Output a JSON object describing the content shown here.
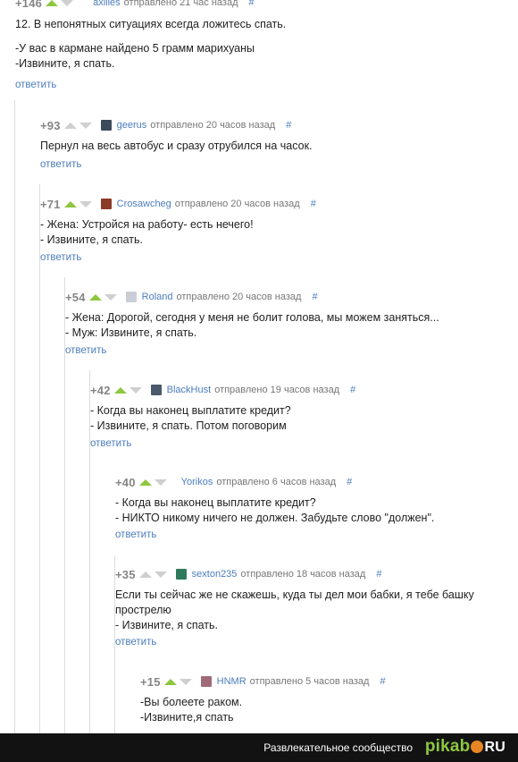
{
  "comments": [
    {
      "score": "+146",
      "author": "axilles",
      "meta": "отправлено 21 час назад",
      "hash": "#",
      "lines": [
        "12. В непонятных ситуациях всегда ложитесь спать.",
        "",
        "-У вас в кармане найдено 5 грамм марихуаны",
        "-Извините, я спать."
      ],
      "reply": "ответить"
    },
    {
      "score": "+93",
      "author": "geerus",
      "meta": "отправлено 20 часов назад",
      "hash": "#",
      "lines": [
        "Пернул на весь автобус и сразу отрубился на часок."
      ],
      "reply": "ответить"
    },
    {
      "score": "+71",
      "author": "Crosawcheg",
      "meta": "отправлено 20 часов назад",
      "hash": "#",
      "lines": [
        "- Жена: Устройся на работу- есть нечего!",
        "- Извините, я спать."
      ],
      "reply": "ответить"
    },
    {
      "score": "+54",
      "author": "Roland",
      "meta": "отправлено 20 часов назад",
      "hash": "#",
      "lines": [
        "- Жена: Дорогой, сегодня у меня не болит голова, мы можем заняться...",
        "- Муж: Извините, я спать."
      ],
      "reply": "ответить"
    },
    {
      "score": "+42",
      "author": "BlackHust",
      "meta": "отправлено 19 часов назад",
      "hash": "#",
      "lines": [
        "- Когда вы наконец выплатите кредит?",
        "- Извините, я спать. Потом поговорим"
      ],
      "reply": "ответить"
    },
    {
      "score": "+40",
      "author": "Yorikos",
      "meta": "отправлено 6 часов назад",
      "hash": "#",
      "lines": [
        "- Когда вы наконец выплатите кредит?",
        "- НИКТО никому ничего не должен. Забудьте слово \"должен\"."
      ],
      "reply": "ответить"
    },
    {
      "score": "+35",
      "author": "sexton235",
      "meta": "отправлено 18 часов назад",
      "hash": "#",
      "lines": [
        "Если ты сейчас же не скажешь, куда ты дел мои бабки, я тебе башку",
        "прострелю",
        "- Извините, я спать."
      ],
      "reply": "ответить"
    },
    {
      "score": "+15",
      "author": "HNMR",
      "meta": "отправлено 5 часов назад",
      "hash": "#",
      "lines": [
        "-Вы болеете раком.",
        "-Извините,я спать"
      ],
      "reply": ""
    }
  ],
  "footer": {
    "tagline": "Развлекательное сообщество",
    "logo_left": "pikab",
    "logo_right": "RU"
  },
  "colors": {
    "link": "#4b7dbc",
    "upvote": "#8ec63f",
    "inactive_arrow": "#cfcfcf",
    "score": "#858585",
    "footer_bg": "#121212",
    "logo_ball": "#e88522"
  }
}
